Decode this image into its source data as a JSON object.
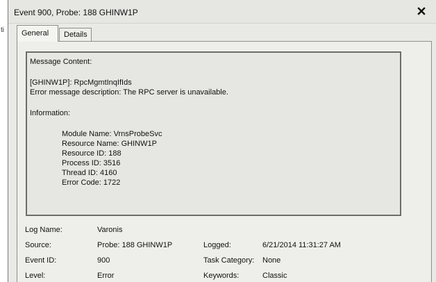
{
  "left_fragment": "ti",
  "window": {
    "title": "Event 900, Probe: 188  GHINW1P"
  },
  "tabs": [
    {
      "label": "General",
      "active": true
    },
    {
      "label": "Details",
      "active": false
    }
  ],
  "message": {
    "heading": "Message Content:",
    "rpc_line": "[GHINW1P]: RpcMgmtInqIfIds",
    "error_desc": "Error message description: The RPC server is unavailable.",
    "info_heading": "Information:",
    "module": "Module Name: VrnsProbeSvc",
    "resource_name": "Resource Name: GHINW1P",
    "resource_id": "Resource ID: 188",
    "process_id": "Process ID: 3516",
    "thread_id": "Thread ID: 4160",
    "error_code": "Error Code: 1722"
  },
  "properties": {
    "log_name_label": "Log Name:",
    "log_name_value": "Varonis",
    "source_label": "Source:",
    "source_value": "Probe: 188  GHINW1P",
    "logged_label": "Logged:",
    "logged_value": "6/21/2014 11:31:27 AM",
    "event_id_label": "Event ID:",
    "event_id_value": "900",
    "task_category_label": "Task Category:",
    "task_category_value": "None",
    "level_label": "Level:",
    "level_value": "Error",
    "keywords_label": "Keywords:",
    "keywords_value": "Classic"
  }
}
